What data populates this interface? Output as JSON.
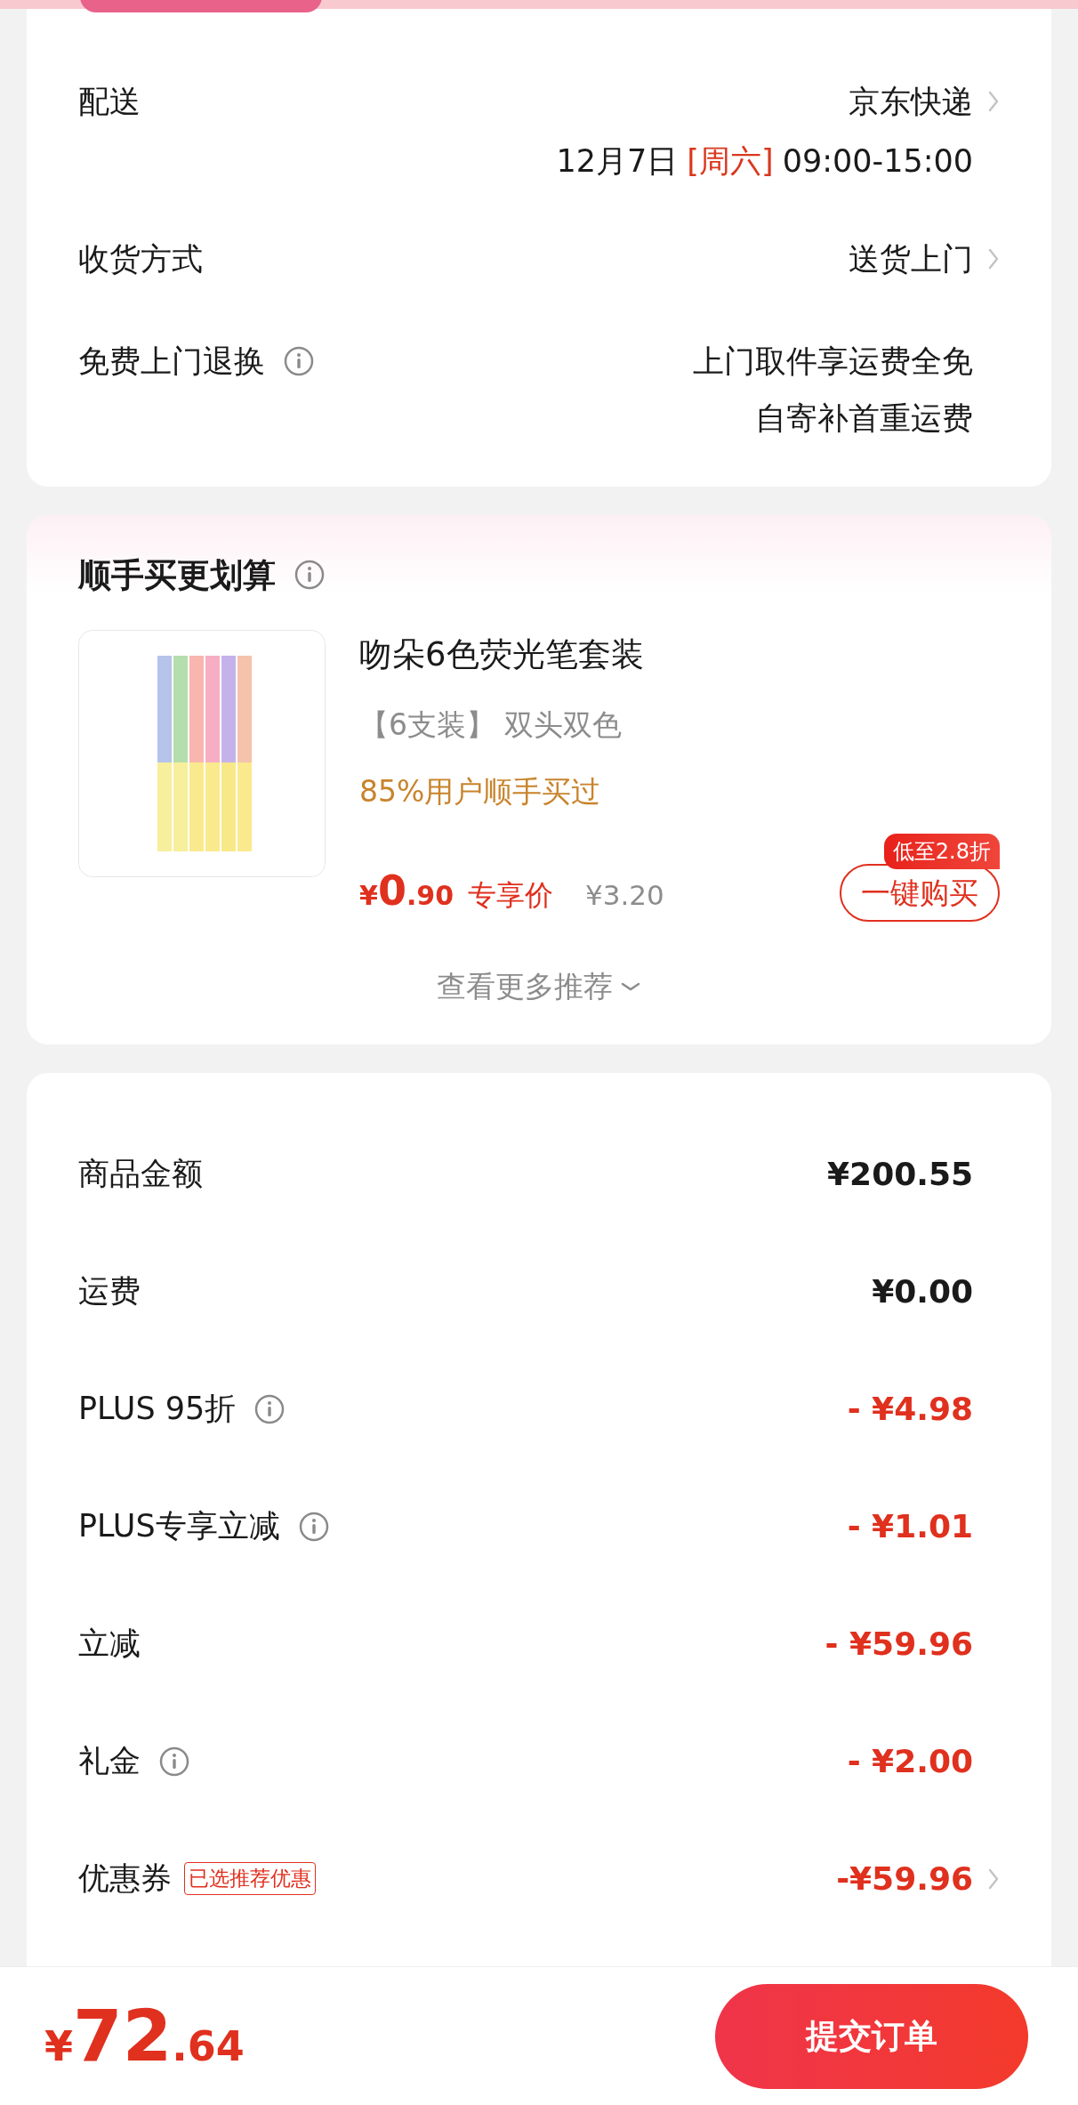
{
  "delivery_card": {
    "shipping": {
      "label": "配送",
      "value": "京东快递",
      "date": "12月7日",
      "weekday": "[周六]",
      "time": "09:00-15:00"
    },
    "receive": {
      "label": "收货方式",
      "value": "送货上门"
    },
    "returns": {
      "label": "免费上门退换",
      "lines": [
        "上门取件享运费全免",
        "自寄补首重运费"
      ]
    }
  },
  "recommend": {
    "title": "顺手买更划算",
    "product": {
      "name": "吻朵6色荧光笔套装",
      "spec": "【6支装】 双头双色",
      "social": "85%用户顺手买过",
      "currency": "¥",
      "price_int": "0",
      "price_dec": ".90",
      "price_label": "专享价",
      "original_price": "¥3.20",
      "discount_badge": "低至2.8折",
      "buy_button": "一键购买"
    },
    "more": "查看更多推荐"
  },
  "summary": [
    {
      "label": "商品金额",
      "kind": "plain",
      "info": false,
      "arrow": false,
      "amount": "¥200.55"
    },
    {
      "label": "运费",
      "kind": "plain",
      "info": false,
      "arrow": false,
      "amount": "¥0.00"
    },
    {
      "label": "PLUS 95折",
      "kind": "discount",
      "info": true,
      "arrow": false,
      "amount": "- ¥4.98"
    },
    {
      "label": "PLUS专享立减",
      "kind": "discount",
      "info": true,
      "arrow": false,
      "amount": "- ¥1.01"
    },
    {
      "label": "立减",
      "kind": "discount",
      "info": false,
      "arrow": false,
      "amount": "- ¥59.96"
    },
    {
      "label": "礼金",
      "kind": "discount",
      "info": true,
      "arrow": false,
      "amount": "- ¥2.00"
    },
    {
      "label": "优惠券",
      "kind": "discount",
      "info": false,
      "arrow": true,
      "tag": "已选推荐优惠",
      "amount": "-¥59.96"
    }
  ],
  "footer": {
    "currency": "¥",
    "price_int": "72",
    "price_dec": ".64",
    "submit": "提交订单"
  }
}
